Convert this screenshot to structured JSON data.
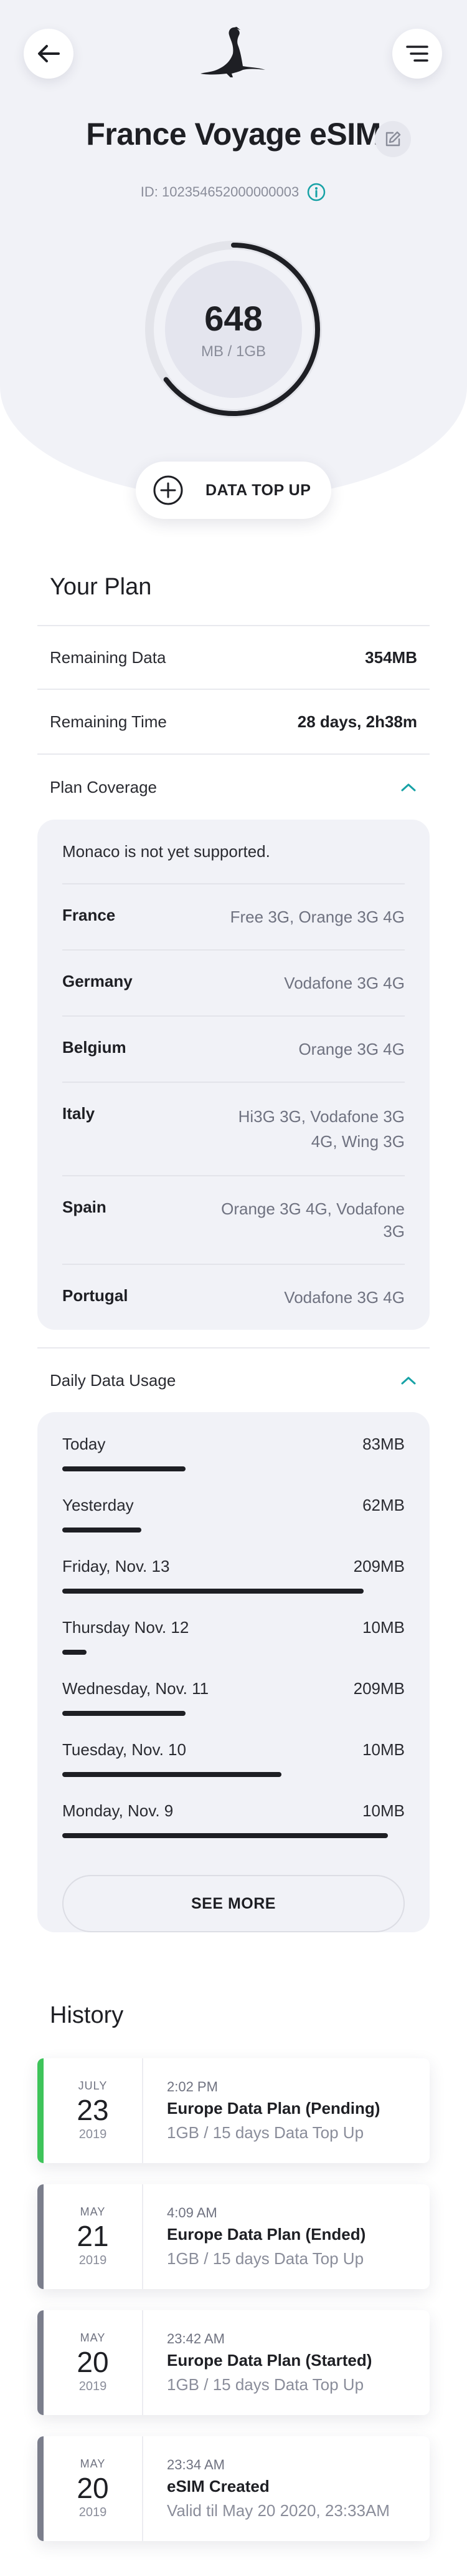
{
  "header": {
    "back_icon": "arrow-left-icon",
    "menu_icon": "hamburger-menu-icon",
    "logo": "bird-logo"
  },
  "esim": {
    "title": "France Voyage eSIM",
    "id_text": "ID: 102354652000000003",
    "edit_icon": "pencil-edit-icon",
    "info_icon": "info-icon"
  },
  "gauge": {
    "value": "648",
    "unit": "MB / 1GB",
    "fraction": 0.648,
    "accent": "#1e1f24"
  },
  "topup": {
    "label": "DATA TOP UP",
    "icon": "plus-circle-icon"
  },
  "plan": {
    "title": "Your Plan",
    "remaining_data": {
      "label": "Remaining Data",
      "value": "354MB"
    },
    "remaining_time": {
      "label": "Remaining Time",
      "value": "28 days, 2h38m"
    }
  },
  "coverage": {
    "label": "Plan Coverage",
    "note": "Monaco is not yet supported.",
    "rows": [
      {
        "country": "France",
        "networks": "Free 3G, Orange 3G 4G"
      },
      {
        "country": "Germany",
        "networks": "Vodafone 3G 4G"
      },
      {
        "country": "Belgium",
        "networks": "Orange 3G 4G"
      },
      {
        "country": "Italy",
        "networks": "Hi3G 3G, Vodafone 3G 4G, Wing 3G"
      },
      {
        "country": "Spain",
        "networks": "Orange 3G 4G, Vodafone 3G"
      },
      {
        "country": "Portugal",
        "networks": "Vodafone 3G 4G"
      }
    ]
  },
  "usage": {
    "label": "Daily Data Usage",
    "rows": [
      {
        "day": "Today",
        "amount": "83MB",
        "level": 0.36
      },
      {
        "day": "Yesterday",
        "amount": "62MB",
        "level": 0.23
      },
      {
        "day": "Friday, Nov. 13",
        "amount": "209MB",
        "level": 0.88
      },
      {
        "day": "Thursday Nov. 12",
        "amount": "10MB",
        "level": 0.07
      },
      {
        "day": "Wednesday, Nov. 11",
        "amount": "209MB",
        "level": 0.36
      },
      {
        "day": "Tuesday, Nov. 10",
        "amount": "10MB",
        "level": 0.64
      },
      {
        "day": "Monday, Nov. 9",
        "amount": "10MB",
        "level": 0.95
      }
    ],
    "see_more": "SEE MORE"
  },
  "history": {
    "title": "History",
    "items": [
      {
        "month": "JULY",
        "day": "23",
        "year": "2019",
        "time": "2:02 PM",
        "title": "Europe Data Plan (Pending)",
        "subtitle": "1GB / 15 days Data Top Up",
        "color": "#3ec45a"
      },
      {
        "month": "MAY",
        "day": "21",
        "year": "2019",
        "time": "4:09 AM",
        "title": "Europe Data Plan (Ended)",
        "subtitle": "1GB / 15 days Data Top Up",
        "color": "#7b7e8c"
      },
      {
        "month": "MAY",
        "day": "20",
        "year": "2019",
        "time": "23:42 AM",
        "title": "Europe Data Plan (Started)",
        "subtitle": "1GB / 15 days Data Top Up",
        "color": "#7b7e8c"
      },
      {
        "month": "MAY",
        "day": "20",
        "year": "2019",
        "time": "23:34 AM",
        "title": "eSIM Created",
        "subtitle": "Valid til May 20 2020, 23:33AM",
        "color": "#7b7e8c"
      }
    ]
  }
}
